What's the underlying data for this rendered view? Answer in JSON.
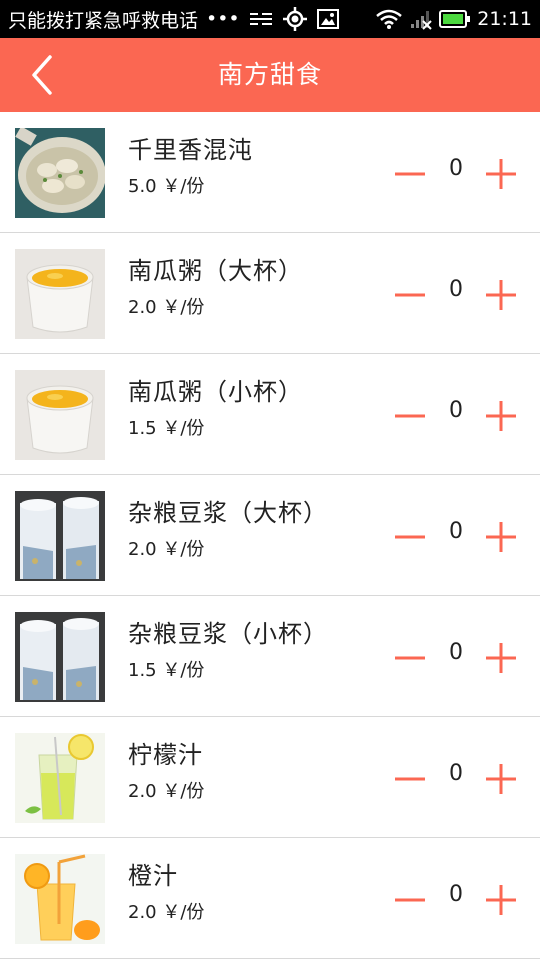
{
  "status_bar": {
    "carrier_text": "只能拨打紧急呼救电话",
    "dots": "•••",
    "time": "21:11"
  },
  "app_bar": {
    "title": "南方甜食"
  },
  "colors": {
    "accent": "#fb6752",
    "status_bar_bg": "#000000"
  },
  "items": [
    {
      "name": "千里香混沌",
      "price": "5.0 ￥/份",
      "qty": "0",
      "image": "wonton-soup-image"
    },
    {
      "name": "南瓜粥（大杯）",
      "price": "2.0 ￥/份",
      "qty": "0",
      "image": "pumpkin-porridge-image"
    },
    {
      "name": "南瓜粥（小杯）",
      "price": "1.5 ￥/份",
      "qty": "0",
      "image": "pumpkin-porridge-image"
    },
    {
      "name": "杂粮豆浆（大杯）",
      "price": "2.0 ￥/份",
      "qty": "0",
      "image": "soy-milk-image"
    },
    {
      "name": "杂粮豆浆（小杯）",
      "price": "1.5 ￥/份",
      "qty": "0",
      "image": "soy-milk-image"
    },
    {
      "name": "柠檬汁",
      "price": "2.0 ￥/份",
      "qty": "0",
      "image": "lemon-juice-image"
    },
    {
      "name": "橙汁",
      "price": "2.0 ￥/份",
      "qty": "0",
      "image": "orange-juice-image"
    }
  ]
}
